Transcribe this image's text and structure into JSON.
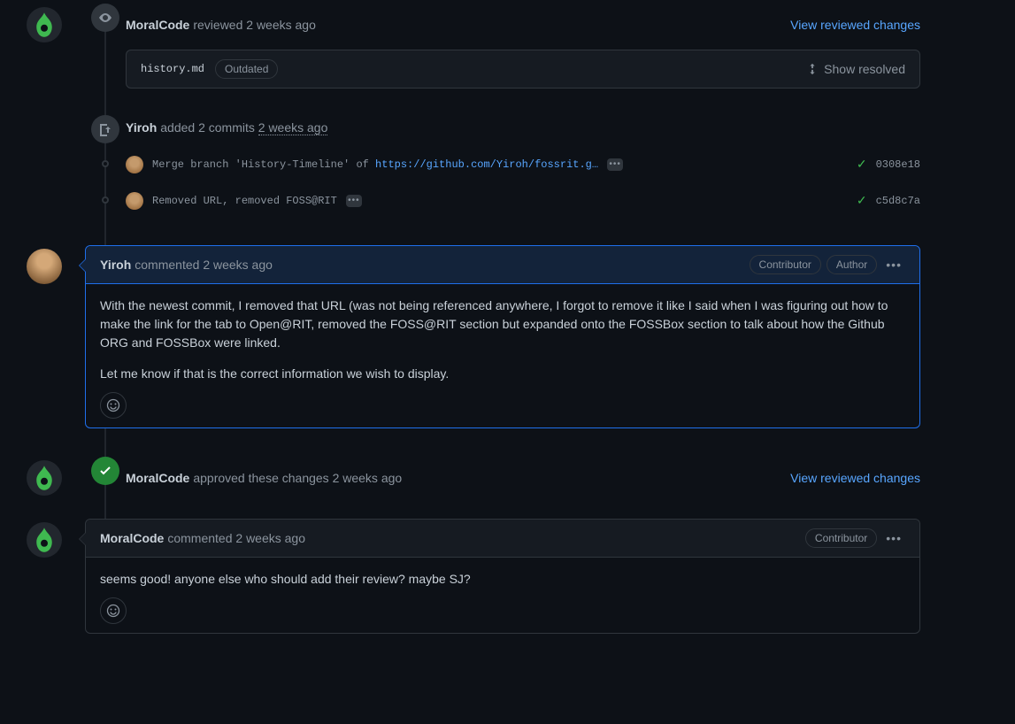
{
  "review1": {
    "user": "MoralCode",
    "action": "reviewed",
    "time": "2 weeks ago",
    "link": "View reviewed changes",
    "file": "history.md",
    "outdated": "Outdated",
    "show_resolved": "Show resolved"
  },
  "commits": {
    "user": "Yiroh",
    "action": "added 2 commits",
    "time": "2 weeks ago",
    "list": [
      {
        "msg_prefix": "Merge branch 'History-Timeline' of ",
        "msg_link": "https://github.com/Yiroh/fossrit.g…",
        "sha": "0308e18"
      },
      {
        "msg_prefix": "Removed URL, removed FOSS@RIT",
        "msg_link": "",
        "sha": "c5d8c7a"
      }
    ]
  },
  "comment1": {
    "user": "Yiroh",
    "action": "commented",
    "time": "2 weeks ago",
    "badges": [
      "Contributor",
      "Author"
    ],
    "p1": "With the newest commit, I removed that URL (was not being referenced anywhere, I forgot to remove it like I said when I was figuring out how to make the link for the tab to Open@RIT, removed the FOSS@RIT section but expanded onto the FOSSBox section to talk about how the Github ORG and FOSSBox were linked.",
    "p2": "Let me know if that is the correct information we wish to display."
  },
  "approve": {
    "user": "MoralCode",
    "action": "approved these changes",
    "time": "2 weeks ago",
    "link": "View reviewed changes"
  },
  "comment2": {
    "user": "MoralCode",
    "action": "commented",
    "time": "2 weeks ago",
    "badges": [
      "Contributor"
    ],
    "p1": "seems good! anyone else who should add their review? maybe SJ?"
  },
  "icons": {
    "ellipsis": "•••",
    "kebab": "•••",
    "smile": "☺",
    "check": "✓"
  }
}
